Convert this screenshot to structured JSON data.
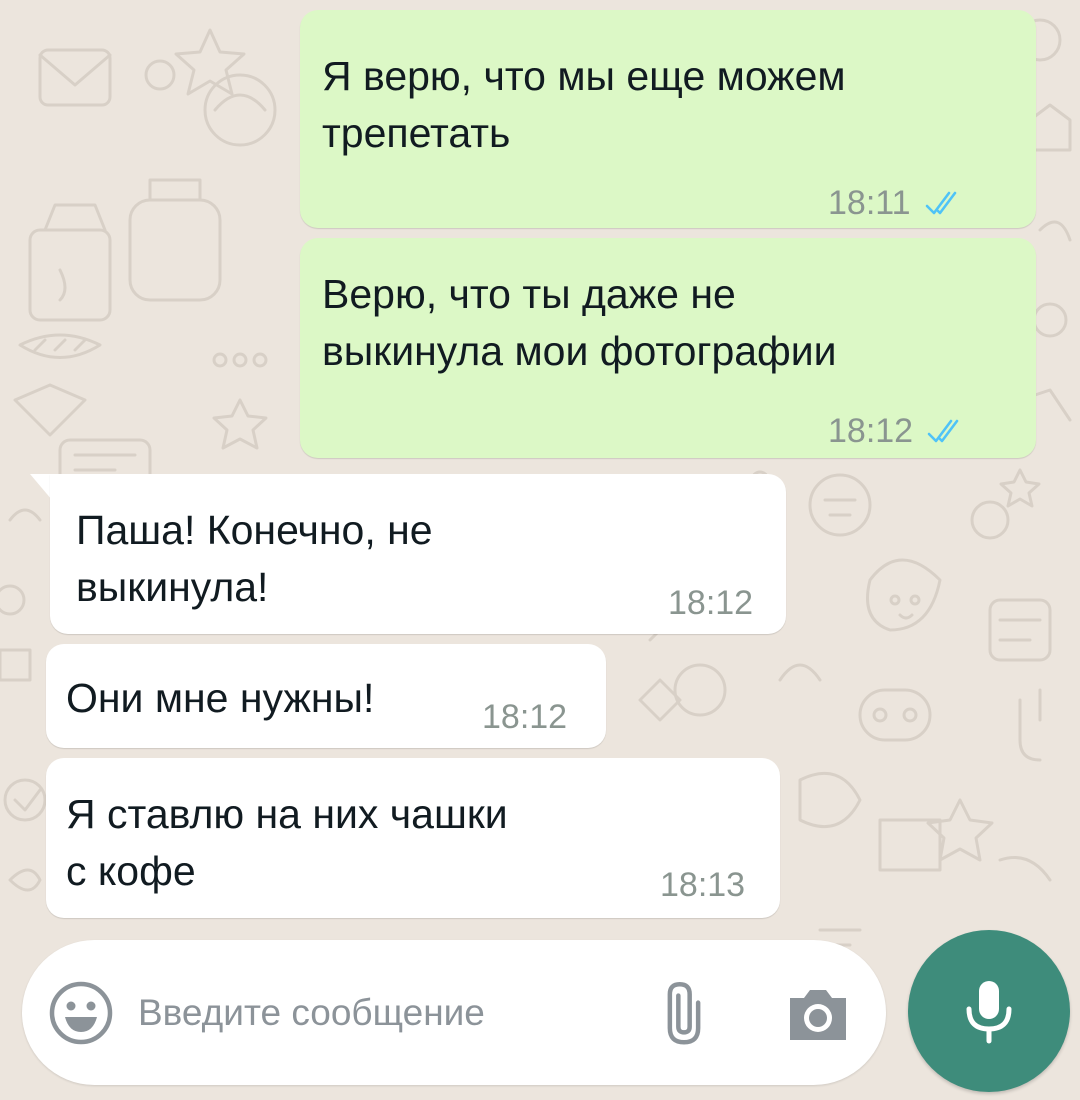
{
  "colors": {
    "outgoing_bubble": "#DCF8C6",
    "incoming_bubble": "#FFFFFF",
    "wallpaper": "#ECE5DD",
    "read_ticks": "#4FC3F7",
    "mic_button": "#3E8C7B"
  },
  "messages": [
    {
      "direction": "out",
      "text": "Я верю, что мы еще можем\nтрепетать",
      "time": "18:11",
      "status": "read"
    },
    {
      "direction": "out",
      "text": "Верю, что ты даже не\nвыкинула мои фотографии",
      "time": "18:12",
      "status": "read"
    },
    {
      "direction": "in",
      "text": "Паша! Конечно, не\nвыкинула!",
      "time": "18:12"
    },
    {
      "direction": "in",
      "text": "Они мне нужны!",
      "time": "18:12"
    },
    {
      "direction": "in",
      "text": "Я ставлю на них чашки\nс кофе",
      "time": "18:13"
    }
  ],
  "composer": {
    "placeholder": "Введите сообщение",
    "value": "",
    "emoji_icon": "emoji-icon",
    "attach_icon": "paperclip-icon",
    "camera_icon": "camera-icon",
    "mic_icon": "microphone-icon"
  }
}
